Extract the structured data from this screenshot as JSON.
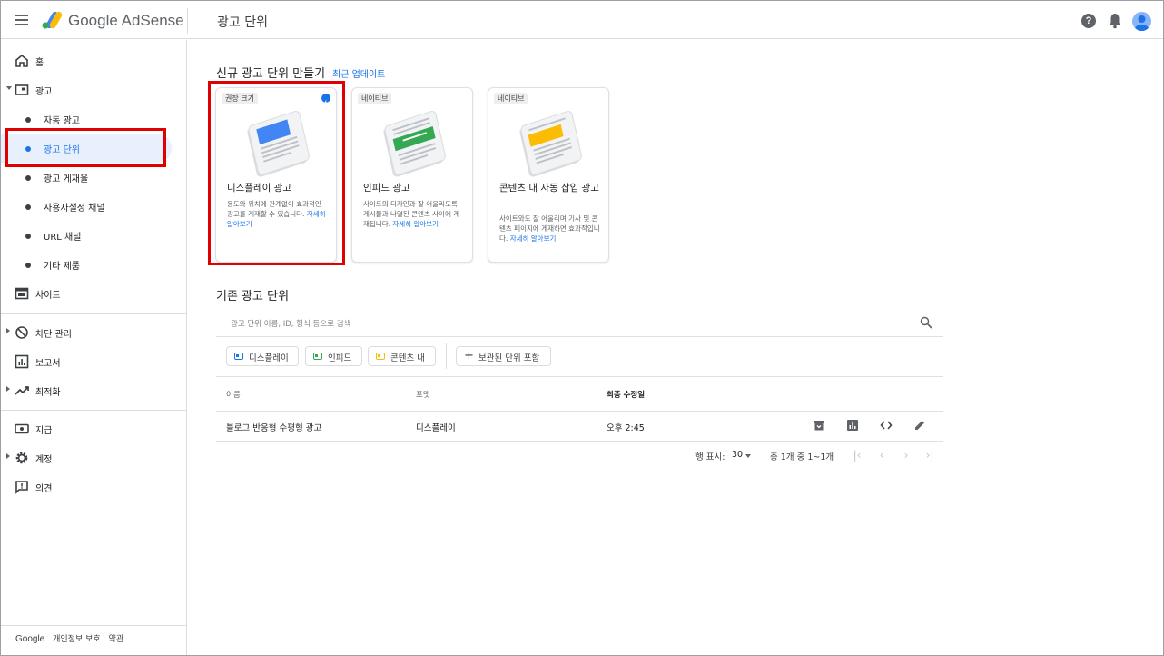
{
  "topbar": {
    "brand": "Google AdSense",
    "page_title": "광고 단위"
  },
  "sidebar": {
    "home": "홈",
    "ads": "광고",
    "ads_children": [
      "자동 광고",
      "광고 단위",
      "광고 게재율",
      "사용자설정 채널",
      "URL 채널",
      "기타 제품"
    ],
    "sites": "사이트",
    "blocking": "차단 관리",
    "reports": "보고서",
    "optimization": "최적화",
    "payments": "지급",
    "account": "계정",
    "feedback": "의견",
    "footer": {
      "google": "Google",
      "privacy": "개인정보 보호",
      "terms": "약관"
    }
  },
  "create": {
    "heading": "신규 광고 단위 만들기",
    "recent_updates": "최근 업데이트",
    "cards": [
      {
        "chip": "권장 크기",
        "title": "디스플레이 광고",
        "desc": "용도와 위치에 관계없이 효과적인 광고를 게재할 수 있습니다.",
        "learn": "자세히 알아보기",
        "accent": "#4285f4"
      },
      {
        "chip": "네이티브",
        "title": "인피드 광고",
        "desc": "사이트의 디자인과 잘 어울리도록 게시물과 나열된 콘텐츠 사이에 게재됩니다.",
        "learn": "자세히 알아보기",
        "accent": "#34a853"
      },
      {
        "chip": "네이티브",
        "title": "콘텐츠 내 자동 삽입 광고",
        "desc": "사이트와도 잘 어울리며 기사 및 콘텐츠 페이지에 게재하면 효과적입니다.",
        "learn": "자세히 알아보기",
        "accent": "#fbbc04"
      }
    ]
  },
  "existing": {
    "heading": "기존 광고 단위",
    "search_placeholder": "광고 단위 이름, ID, 형식 등으로 검색",
    "filters": {
      "display": "디스플레이",
      "infeed": "인피드",
      "incontent": "콘텐츠 내",
      "archived": "보관된 단위 포함"
    },
    "columns": {
      "name": "이름",
      "format": "포맷",
      "modified": "최종 수정일"
    },
    "rows": [
      {
        "name": "블로그 반응형 수평형 광고",
        "format": "디스플레이",
        "modified": "오후 2:45"
      }
    ],
    "pagination": {
      "rows_label": "행 표시:",
      "rows_value": "30",
      "range": "총 1개 중 1~1개"
    }
  },
  "colors": {
    "accent": "#1a73e8",
    "highlight": "#e00000"
  }
}
